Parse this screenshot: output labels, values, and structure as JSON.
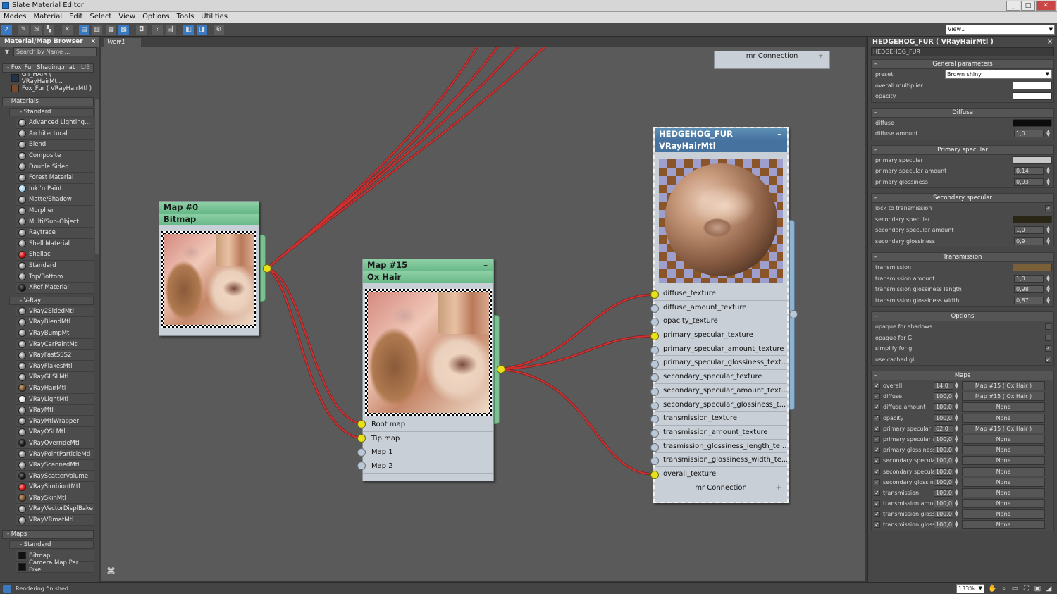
{
  "window": {
    "title": "Slate Material Editor",
    "buttons": [
      "_",
      "□",
      "✕"
    ]
  },
  "menu": [
    "Modes",
    "Material",
    "Edit",
    "Select",
    "View",
    "Options",
    "Tools",
    "Utilities"
  ],
  "toolbar": {
    "view_select": "View1"
  },
  "browser": {
    "title": "Material/Map Browser",
    "search_placeholder": "Search by Name ...",
    "library": {
      "name": "Fox_Fur_Shading.mat",
      "tag": "LIB",
      "items": [
        "Gil_HAIR ( VRayHairMt...",
        "Fox_Fur ( VRayHairMtl )"
      ]
    },
    "materials_label": "Materials",
    "standard_label": "Standard",
    "standard_items": [
      "Advanced Lighting...",
      "Architectural",
      "Blend",
      "Composite",
      "Double Sided",
      "Forest Material",
      "Ink 'n Paint",
      "Matte/Shadow",
      "Morpher",
      "Multi/Sub-Object",
      "Raytrace",
      "Shell Material",
      "Shellac",
      "Standard",
      "Top/Bottom",
      "XRef Material"
    ],
    "vray_label": "V-Ray",
    "vray_items": [
      "VRay2SidedMtl",
      "VRayBlendMtl",
      "VRayBumpMtl",
      "VRayCarPaintMtl",
      "VRayFastSSS2",
      "VRayFlakesMtl",
      "VRayGLSLMtl",
      "VRayHairMtl",
      "VRayLightMtl",
      "VRayMtl",
      "VRayMtlWrapper",
      "VRayOSLMtl",
      "VRayOverrideMtl",
      "VRayPointParticleMtl",
      "VRayScannedMtl",
      "VRayScatterVolume",
      "VRaySimbiontMtl",
      "VRaySkinMtl",
      "VRayVectorDisplBake",
      "VRayVRmatMtl"
    ],
    "maps_label": "Maps",
    "maps_standard_label": "Standard",
    "maps_items": [
      "Bitmap",
      "Camera Map Per Pixel"
    ]
  },
  "view_tab": "View1",
  "nodes": {
    "bitmap": {
      "title": "Map #0",
      "subtitle": "Bitmap"
    },
    "oxhair": {
      "title": "Map #15",
      "subtitle": "Ox Hair",
      "slots": [
        "Root map",
        "Tip map",
        "Map 1",
        "Map 2"
      ]
    },
    "hedgehog": {
      "title": "HEDGEHOG_FUR",
      "subtitle": "VRayHairMtl",
      "slots": [
        "diffuse_texture",
        "diffuse_amount_texture",
        "opacity_texture",
        "primary_specular_texture",
        "primary_specular_amount_texture",
        "primary_specular_glossiness_text...",
        "secondary_specular_texture",
        "secondary_specular_amount_text...",
        "secondary_specular_glossiness_t...",
        "transmission_texture",
        "transmission_amount_texture",
        "trasmission_glossiness_length_te...",
        "transmission_glossiness_width_te...",
        "overall_texture"
      ],
      "footer": "mr Connection"
    },
    "mr_connection_top": "mr Connection"
  },
  "properties": {
    "header": "HEDGEHOG_FUR  ( VRayHairMtl )",
    "name": "HEDGEHOG_FUR",
    "general": {
      "title": "General parameters",
      "preset_label": "preset",
      "preset_value": "Brown shiny",
      "overall_label": "overall multiplier",
      "opacity_label": "opacity"
    },
    "diffuse": {
      "title": "Diffuse",
      "diffuse_label": "diffuse",
      "amount_label": "diffuse amount",
      "amount_value": "1,0"
    },
    "primary": {
      "title": "Primary specular",
      "spec_label": "primary specular",
      "amount_label": "primary specular amount",
      "amount_value": "0,14",
      "gloss_label": "primary glossiness",
      "gloss_value": "0,93"
    },
    "secondary": {
      "title": "Secondary specular",
      "lock_label": "lock to transmission",
      "spec_label": "secondary specular",
      "amount_label": "secondary specular amount",
      "amount_value": "1,0",
      "gloss_label": "secondary glossiness",
      "gloss_value": "0,9"
    },
    "transmission": {
      "title": "Transmission",
      "trans_label": "transmission",
      "amount_label": "transmission amount",
      "amount_value": "1,0",
      "len_label": "transmission glossiness length",
      "len_value": "0,98",
      "wid_label": "transmission glossiness width",
      "wid_value": "0,87"
    },
    "options": {
      "title": "Options",
      "o1": "opaque for shadows",
      "o2": "opaque for GI",
      "o3": "simplify for gi",
      "o4": "use cached gi"
    },
    "maps": {
      "title": "Maps",
      "rows": [
        {
          "label": "overall",
          "value": "14,0",
          "map": "Map #15  ( Ox Hair )"
        },
        {
          "label": "diffuse",
          "value": "100,0",
          "map": "Map #15  ( Ox Hair )"
        },
        {
          "label": "diffuse amount",
          "value": "100,0",
          "map": "None"
        },
        {
          "label": "opacity",
          "value": "100,0",
          "map": "None"
        },
        {
          "label": "primary specular",
          "value": "62,0",
          "map": "Map #15  ( Ox Hair )"
        },
        {
          "label": "primary specular ar",
          "value": "100,0",
          "map": "None"
        },
        {
          "label": "primary glossiness",
          "value": "100,0",
          "map": "None"
        },
        {
          "label": "secondary specula",
          "value": "100,0",
          "map": "None"
        },
        {
          "label": "secondary specula",
          "value": "100,0",
          "map": "None"
        },
        {
          "label": "secondary glossine",
          "value": "100,0",
          "map": "None"
        },
        {
          "label": "transmission",
          "value": "100,0",
          "map": "None"
        },
        {
          "label": "transmission amou",
          "value": "100,0",
          "map": "None"
        },
        {
          "label": "transmission glossi",
          "value": "100,0",
          "map": "None"
        },
        {
          "label": "transmission glossi",
          "value": "100,0",
          "map": "None"
        }
      ]
    }
  },
  "status": {
    "text": "Rendering finished",
    "zoom": "133%"
  },
  "colors": {
    "wire": "#c82a2a",
    "node_header_green": "#7cc49a",
    "node_header_blue": "#4d7fa3",
    "socket_yellow": "#e8e11a",
    "diffuse_swatch": "#0c0c0c",
    "primary_specular_swatch": "#c8c8c8",
    "secondary_specular_swatch": "#2a2616",
    "transmission_swatch": "#7a6038",
    "white_swatch": "#ffffff"
  }
}
